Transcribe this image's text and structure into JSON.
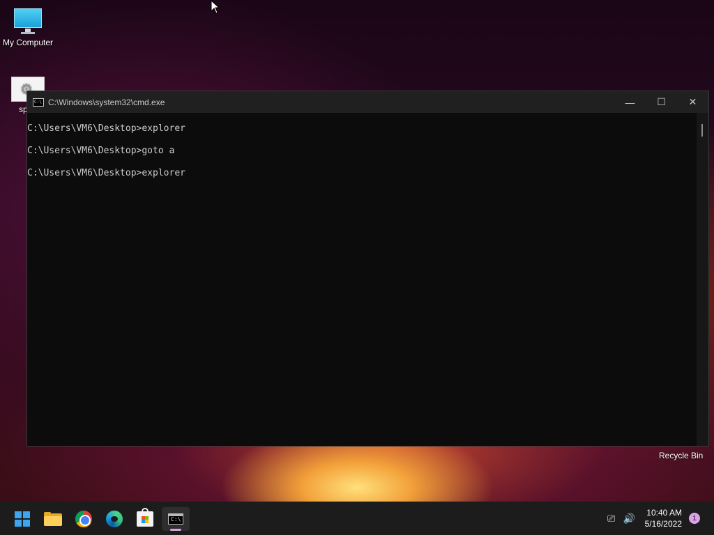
{
  "desktop": {
    "icons": [
      {
        "label": "My Computer"
      },
      {
        "label": "span"
      }
    ],
    "recycle_bin_label": "Recycle Bin"
  },
  "cmd_window": {
    "title": "C:\\Windows\\system32\\cmd.exe",
    "icon_text": "C:\\",
    "lines": [
      "C:\\Users\\VM6\\Desktop>explorer",
      "C:\\Users\\VM6\\Desktop>goto a",
      "C:\\Users\\VM6\\Desktop>explorer"
    ],
    "controls": {
      "minimize": "—",
      "maximize": "☐",
      "close": "✕"
    }
  },
  "taskbar": {
    "pinned": [
      "start-icon",
      "file-explorer-icon",
      "chrome-icon",
      "edge-icon",
      "store-icon",
      "cmd-icon"
    ],
    "active_app": "cmd-icon",
    "tray": {
      "network_icon": "⎚",
      "volume_icon": "🔊",
      "time": "10:40 AM",
      "date": "5/16/2022",
      "notification_count": "1"
    },
    "colors": {
      "accent": "#3aa7f0",
      "badge": "#d9a3e6"
    }
  }
}
